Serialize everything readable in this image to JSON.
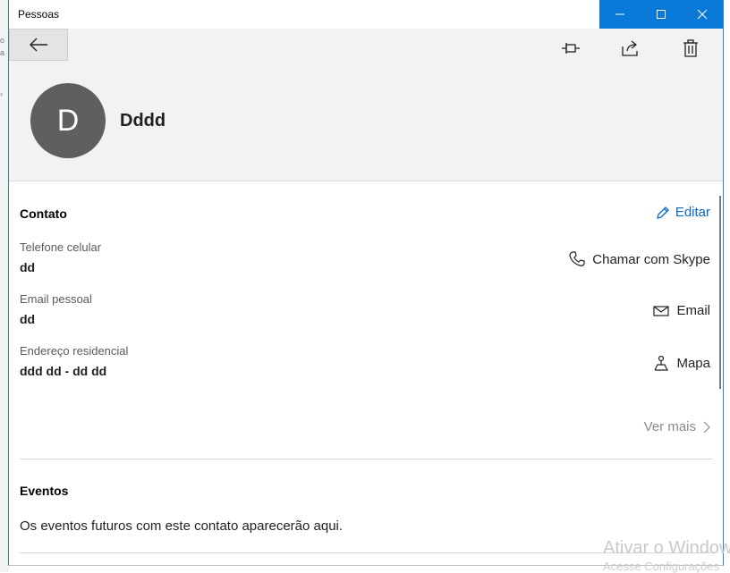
{
  "window": {
    "title": "Pessoas"
  },
  "header": {
    "avatar_letter": "D",
    "contact_name": "Dddd"
  },
  "contact": {
    "section_title": "Contato",
    "edit_label": "Editar",
    "fields": [
      {
        "label": "Telefone celular",
        "value": "dd",
        "action_label": "Chamar com Skype",
        "action_icon": "phone-icon"
      },
      {
        "label": "Email pessoal",
        "value": "dd",
        "action_label": "Email",
        "action_icon": "mail-icon"
      },
      {
        "label": "Endereço residencial",
        "value": "ddd dd - dd dd",
        "action_label": "Mapa",
        "action_icon": "map-pin-icon"
      }
    ],
    "see_more_label": "Ver mais"
  },
  "events": {
    "section_title": "Eventos",
    "empty_text": "Os eventos futuros com este contato aparecerão aqui."
  },
  "watermark": {
    "line1": "Ativar o Windows",
    "line2": "Acesse Configurações"
  },
  "colors": {
    "accent": "#0a78d7",
    "link": "#0a67c2",
    "avatar_bg": "#5f5f5f",
    "header_bg": "#f2f2f2"
  }
}
